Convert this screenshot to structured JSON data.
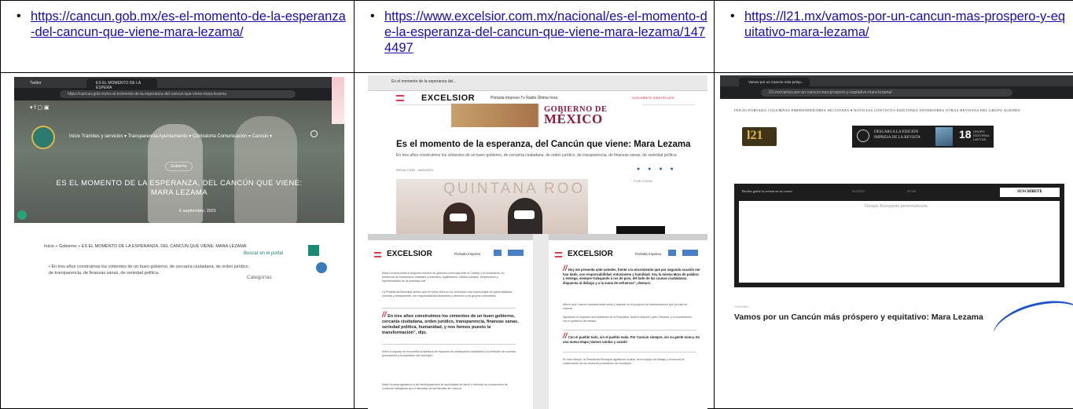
{
  "links": [
    {
      "url": "https://cancun.gob.mx/es-el-momento-de-la-esperanza-del-cancun-que-viene-mara-lezama/"
    },
    {
      "url": "https://www.excelsior.com.mx/nacional/es-el-momento-de-la-esperanza-del-cancun-que-viene-mara-lezama/1474497"
    },
    {
      "url": "https://l21.mx/vamos-por-un-cancun-mas-prospero-y-equitativo-mara-lezama/"
    }
  ],
  "shot1": {
    "tab_title": "ES EL MOMENTO DE LA ESPERA",
    "tab_title_2": "Twitter",
    "url_text": "https://cancun.gob.mx/es-el-momento-de-la-esperanza-del-cancun-que-viene-mara-lezama",
    "nav": "Inicio   Trámites y servicios ▾   Transparencia   Ayuntamiento ▾   Contraloría   Comunicación ▾   Cancún ▾",
    "category": "Gobierno",
    "title": "ES EL MOMENTO DE LA ESPERANZA, DEL CANCÚN QUE VIENE: MARA LEZAMA",
    "date": "6 septiembre, 2021",
    "breadcrumb_prefix": "Inicio » Gobierno » ",
    "breadcrumb": "ES EL MOMENTO DE LA ESPERANZA, DEL CANCÚN QUE VIENE: MARA LEZAMA",
    "search_portal": "Buscar en el portal",
    "body": "En tres años construimos los cimientos de un buen gobierno, de cercanía ciudadana, de orden jurídico, de transparencia, de finanzas sanas, de seriedad política.",
    "categories": "Categorías"
  },
  "shot2": {
    "tab_title": "Es el momento de la esperanza del...",
    "brand": "EXCELSIOR",
    "nav": "Portada     Impreso     Tv     Radio     Última hora",
    "header_right": "SUSCRÍBETE   IDENTÍFICATE",
    "banner_line1": "GOBIERNO DE",
    "banner_line2": "MÉXICO",
    "headline": "Es el momento de la esperanza, del Cancún que viene: Mara Lezama",
    "lead": "En tres años construimos los cimientos de un buen gobierno, de cercanía ciudadana, de orden jurídico, de transparencia, de finanzas sanas, de seriedad política",
    "byline": "REDACCIÓN · 06/09/2021",
    "photo_text": "QUINTANA ROO  20",
    "publicidad": "PUBLICIDAD"
  },
  "shot3": {
    "brand": "EXCELSIOR",
    "nav": "Portada     Impreso",
    "pageA_text1": "Mara Lezama rindió el segundo informe de gobierno municipal ante el Cabildo y la ciudadanía, en presencia de funcionarios estatales y federales, legisladores, líderes sociales, empresarios y representantes de la sociedad civil.",
    "pageA_text2": "La Presidenta Municipal señaló que en estos años se ha construido una nueva etapa de gobernabilidad, cercana y transparente, con responsabilidad financiera y atención a los grupos vulnerables.",
    "pageA_quote": "En tres años construimos los cimientos de un buen gobierno, cercanía ciudadana, orden jurídico, transparencia, finanzas sanas, seriedad política, humanidad, y nos hemos puesto la transformación\", dijo.",
    "pageA_text3": "Entre lo logrado se encuentra la apertura de espacios de participación ciudadana y la rendición de cuentas permanente a la población del municipio.",
    "pageA_text4": "Mara Lezama agradeció a los benitojuarenses la oportunidad de servir y refrendó su compromiso de continuar trabajando por el bienestar de las familias de Cancún.",
    "pageB_quote1": "Hoy me presento ante ustedes, frente a la encomienda que por segunda ocasión me han dado, con responsabilidad, entusiasmo y humildad. Soy la misma Mara de palabra y entrega, siempre trabajando a ras de piso, del lado de las causas ciudadanas, dispuesta al diálogo y a la suma de esfuerzos\", destacó.",
    "pageB_text1": "Afirmó que Cancún necesita estar unido y avanzar en el proyecto de transformación que ya está en marcha.",
    "pageB_text2": "Agradeció el respaldo del presidente de la República, Andrés Manuel López Obrador, y la coordinación con el gobierno del estado.",
    "pageB_quote2": "Con el pueblo todo, sin el pueblo nada. Por Cancún siempre, sin su gente nunca. Es una nueva etapa ¡Vamos unidos y avanti!",
    "pageB_text3": "En este tiempo, la Presidenta Municipal agradeció la labor de su equipo de trabajo y reconoció la colaboración de los sectores productivos del municipio."
  },
  "shot4": {
    "tab_title": "Vamos por un Cancún más prósp...",
    "url_text": "l21.mx/vamos-por-un-cancun-mas-prospero-y-equitativo-mara-lezama/",
    "menu": "INICIO   PORTADA   COLUMNAS   EMPRENDEDORES   SECCIONES ▾   NOTICIAS   CONTACTO   EDICIONES ANTERIORES   OTRAS REVISTAS DEL GRUPO   AGENDA",
    "logo": "l21",
    "edition_line1": "DESCARGA LA EDICIÓN",
    "edition_line2": "IMPRESA DE LA REVISTA",
    "number": "18",
    "group": "GRUPO EDITORIAL LATITUD",
    "newsletter": "Recibe gratis la revista en tu correo",
    "newsletter_name": "Nombre",
    "newsletter_email": "Email",
    "subscribe": "SUSCRÍBETE",
    "google": "Google  Búsqueda personalizada",
    "topic": "TURISMO",
    "headline": "Vamos por un Cancún más próspero y equitativo: Mara Lezama"
  }
}
